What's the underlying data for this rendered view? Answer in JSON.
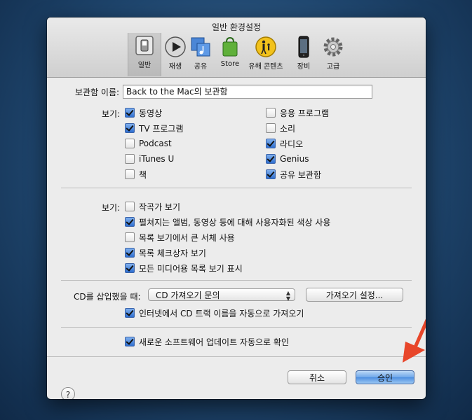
{
  "window": {
    "title": "일반 환경설정"
  },
  "toolbar": {
    "items": [
      {
        "label": "일반",
        "icon": "general-switch-icon"
      },
      {
        "label": "재생",
        "icon": "play-icon"
      },
      {
        "label": "공유",
        "icon": "sharing-icon"
      },
      {
        "label": "Store",
        "icon": "store-bag-icon"
      },
      {
        "label": "유해 콘텐츠",
        "icon": "parental-icon"
      },
      {
        "label": "장비",
        "icon": "device-icon"
      },
      {
        "label": "고급",
        "icon": "gear-icon"
      }
    ],
    "selected": "일반"
  },
  "library_name": {
    "label": "보관함 이름:",
    "value": "Back to the Mac의 보관함"
  },
  "show_sources": {
    "label": "보기:",
    "left": [
      {
        "label": "동영상",
        "checked": true
      },
      {
        "label": "TV 프로그램",
        "checked": true
      },
      {
        "label": "Podcast",
        "checked": false
      },
      {
        "label": "iTunes U",
        "checked": false
      },
      {
        "label": "책",
        "checked": false
      }
    ],
    "right": [
      {
        "label": "응용 프로그램",
        "checked": false
      },
      {
        "label": "소리",
        "checked": false
      },
      {
        "label": "라디오",
        "checked": true
      },
      {
        "label": "Genius",
        "checked": true
      },
      {
        "label": "공유 보관함",
        "checked": true
      }
    ]
  },
  "view_options": {
    "label": "보기:",
    "items": [
      {
        "label": "작곡가 보기",
        "checked": false
      },
      {
        "label": "펼쳐지는 앨범, 동영상 등에 대해 사용자화된 색상 사용",
        "checked": true
      },
      {
        "label": "목록 보기에서 큰 서체 사용",
        "checked": false
      },
      {
        "label": "목록 체크상자 보기",
        "checked": true
      },
      {
        "label": "모든 미디어용 목록 보기 표시",
        "checked": true
      }
    ]
  },
  "cd": {
    "label": "CD를 삽입했을 때:",
    "popup_value": "CD 가져오기 문의",
    "import_settings_button": "가져오기 설정...",
    "auto_names": {
      "label": "인터넷에서 CD 트랙 이름을 자동으로 가져오기",
      "checked": true
    }
  },
  "updates": {
    "label": "새로운 소프트웨어 업데이트 자동으로 확인",
    "checked": true
  },
  "buttons": {
    "help": "?",
    "cancel": "취소",
    "ok": "승인"
  },
  "colors": {
    "annotation_arrow": "#e8462a",
    "default_button": "#5a9be4"
  }
}
